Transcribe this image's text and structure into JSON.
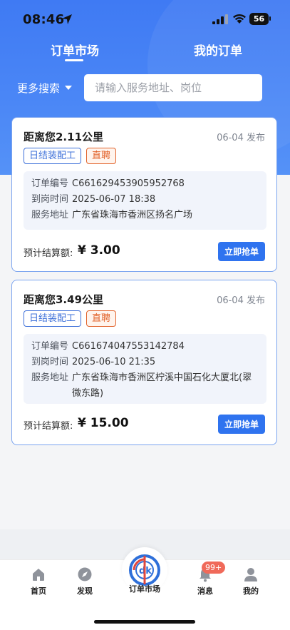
{
  "status_bar": {
    "time": "08:46",
    "battery": "56"
  },
  "tabs": {
    "market": "订单市场",
    "mine": "我的订单"
  },
  "search": {
    "more_label": "更多搜索",
    "placeholder": "请输入服务地址、岗位"
  },
  "orders": [
    {
      "distance": "距离您2.11公里",
      "published": "06-04 发布",
      "badges": [
        "日结装配工",
        "直聘"
      ],
      "order_no_label": "订单编号",
      "order_no": "C661629453905952768",
      "arrival_label": "到岗时间",
      "arrival": "2025-06-07 18:38",
      "address_label": "服务地址",
      "address": "广东省珠海市香洲区扬名广场",
      "price_label": "预计结算额:",
      "price": "¥ 3.00",
      "button": "立即抢单"
    },
    {
      "distance": "距离您3.49公里",
      "published": "06-04 发布",
      "badges": [
        "日结装配工",
        "直聘"
      ],
      "order_no_label": "订单编号",
      "order_no": "C661674047553142784",
      "arrival_label": "到岗时间",
      "arrival": "2025-06-10 21:35",
      "address_label": "服务地址",
      "address": "广东省珠海市香洲区柠溪中国石化大厦北(翠微东路)",
      "price_label": "预计结算额:",
      "price": "¥ 15.00",
      "button": "立即抢单"
    }
  ],
  "tab_bar": {
    "home": "首页",
    "discover": "发现",
    "market": "订单市场",
    "messages": "消息",
    "messages_badge": "99+",
    "me": "我的"
  },
  "colors": {
    "primary": "#2f73ef",
    "header": "#4a86f6",
    "tag_orange": "#e2632b"
  }
}
